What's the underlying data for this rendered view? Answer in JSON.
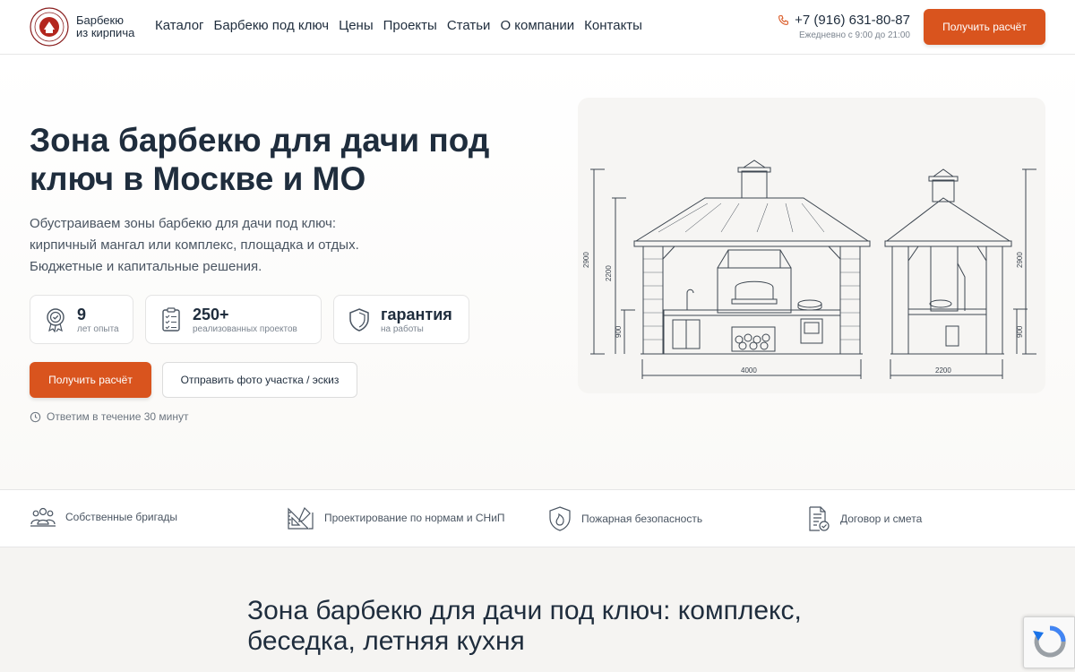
{
  "header": {
    "brand_line1": "Барбекю",
    "brand_line2": "из кирпича",
    "nav": [
      "Каталог",
      "Барбекю под ключ",
      "Цены",
      "Проекты",
      "Статьи",
      "О компании",
      "Контакты"
    ],
    "phone": "+7 (916) 631-80-87",
    "hours": "Ежедневно с 9:00 до 21:00",
    "cta_label": "Получить расчёт"
  },
  "hero": {
    "title": "Зона барбекю для дачи под ключ в Москве и МО",
    "lead": [
      "Обустраиваем зоны барбекю для дачи под ключ:",
      "кирпичный мангал или комплекс, площадка и отдых.",
      "Бюджетные и капитальные решения."
    ],
    "stats": [
      {
        "value": "9",
        "label": "лет опыта"
      },
      {
        "value": "250+",
        "label": "реализованных проектов"
      },
      {
        "value": "гарантия",
        "label": "на работы"
      }
    ],
    "primary_button": "Получить расчёт",
    "secondary_button": "Отправить фото участка / эскиз",
    "response_note": "Ответим в течение 30 минут"
  },
  "drawing": {
    "dims": {
      "left_total_height": "2900",
      "left_inner_height": "2200",
      "left_counter_height": "900",
      "left_width": "4000",
      "right_total_height": "2900",
      "right_counter_height": "900",
      "right_width": "2200"
    }
  },
  "features": [
    {
      "icon": "team-icon",
      "label": "Собственные бригады"
    },
    {
      "icon": "design-ruler-icon",
      "label": "Проектирование по нормам и СНиП"
    },
    {
      "icon": "fire-shield-icon",
      "label": "Пожарная безопасность"
    },
    {
      "icon": "contract-icon",
      "label": "Договор и смета"
    }
  ],
  "section": {
    "title_line1": "Зона барбекю для дачи под ключ: комплекс,",
    "title_line2": "беседка, летняя кухня"
  },
  "colors": {
    "accent": "#d9541e",
    "text": "#1f2d3d",
    "muted": "#7c8590"
  }
}
